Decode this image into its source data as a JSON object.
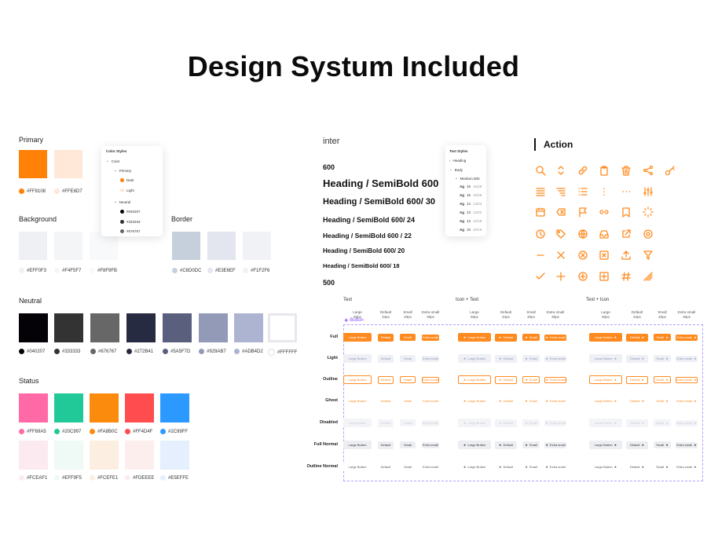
{
  "page": {
    "title": "Design Systum Included"
  },
  "colors": {
    "primary_label": "Primary",
    "primary": [
      {
        "hex": "#FF8108",
        "color": "#FF8108"
      },
      {
        "hex": "#FFE8D7",
        "color": "#FFE8D7"
      }
    ],
    "background_label": "Background",
    "background": [
      {
        "hex": "#EFF0F3",
        "color": "#EFF0F3"
      },
      {
        "hex": "#F4F5F7",
        "color": "#F4F5F7"
      },
      {
        "hex": "#F8F9FB",
        "color": "#F8F9FB"
      }
    ],
    "border_label": "Border",
    "border": [
      {
        "hex": "#C6D0DC",
        "color": "#C6D0DC"
      },
      {
        "hex": "#E3E6EF",
        "color": "#E3E6EF"
      },
      {
        "hex": "#F1F2F6",
        "color": "#F1F2F6"
      }
    ],
    "neutral_label": "Neutral",
    "neutral": [
      {
        "hex": "#040207",
        "color": "#040207"
      },
      {
        "hex": "#333333",
        "color": "#333333"
      },
      {
        "hex": "#676767",
        "color": "#676767"
      },
      {
        "hex": "#272B41",
        "color": "#272B41"
      },
      {
        "hex": "#5A5F7D",
        "color": "#5A5F7D"
      },
      {
        "hex": "#929AB7",
        "color": "#929AB7"
      },
      {
        "hex": "#ADB4D2",
        "color": "#ADB4D2"
      },
      {
        "hex": "#FFFFFF",
        "color": "#FFFFFF"
      }
    ],
    "status_label": "Status",
    "status": [
      {
        "hex": "#FF69A5",
        "color": "#FF69A5"
      },
      {
        "hex": "#20C997",
        "color": "#20C997"
      },
      {
        "hex": "#FA8B0C",
        "color": "#FA8B0C"
      },
      {
        "hex": "#FF4D4F",
        "color": "#FF4D4F"
      },
      {
        "hex": "#2C99FF",
        "color": "#2C99FF"
      }
    ],
    "status_light": [
      {
        "hex": "#FCEAF1",
        "color": "#FCEAF1"
      },
      {
        "hex": "#EFF9F5",
        "color": "#EFF9F5"
      },
      {
        "hex": "#FCEFE1",
        "color": "#FCEFE1"
      },
      {
        "hex": "#FDEEEE",
        "color": "#FDEEEE"
      },
      {
        "hex": "#E5EFFE",
        "color": "#E5EFFE"
      }
    ]
  },
  "color_styles_panel": {
    "title": "Color Styles",
    "root": "Color",
    "primary": "Primary",
    "dark": "Dark",
    "light": "Light",
    "neutral": "Neutral",
    "neutral_items": [
      "#040207",
      "#333333",
      "#676767"
    ]
  },
  "typography": {
    "font": "inter",
    "weight_600": "600",
    "weight_500": "500",
    "headings": [
      "Heading / SemiBold 600",
      "Heading / SemiBold 600/ 30",
      "Heading / SemiBold 600/ 24",
      "Heading / SemiBold 600 / 22",
      "Heading / SemiBold 600/ 20",
      "Heading / SemiBold 600/ 18"
    ]
  },
  "text_styles_panel": {
    "title": "Text Styles",
    "heading": "Heading",
    "body": "Body",
    "medium": "Medium 500",
    "rows": [
      {
        "ag": "Ag",
        "size": "16",
        "lh": "16/28"
      },
      {
        "ag": "Ag",
        "size": "15",
        "lh": "15/26"
      },
      {
        "ag": "Ag",
        "size": "14",
        "lh": "14/24"
      },
      {
        "ag": "Ag",
        "size": "13",
        "lh": "13/22"
      },
      {
        "ag": "Ag",
        "size": "12",
        "lh": "12/18"
      },
      {
        "ag": "Ag",
        "size": "10",
        "lh": "10/16"
      }
    ]
  },
  "action": {
    "title": "Action",
    "icons": [
      [
        "search-icon",
        "chevron-up-down-icon",
        "link-icon",
        "clipboard-icon",
        "trash-icon",
        "share-icon",
        "key-icon"
      ],
      [
        "align-center-icon",
        "align-right-icon",
        "list-icon",
        "more-vertical-icon",
        "more-horizontal-icon",
        "sliders-icon"
      ],
      [
        "calendar-icon",
        "backspace-icon",
        "flag-icon",
        "link-alt-icon",
        "bookmark-icon",
        "loader-icon"
      ],
      [
        "clock-icon",
        "tag-icon",
        "globe-icon",
        "inbox-icon",
        "external-link-icon",
        "settings-icon"
      ],
      [
        "minus-icon",
        "close-icon",
        "close-circle-icon",
        "close-square-icon",
        "upload-icon",
        "filter-icon"
      ],
      [
        "check-icon",
        "plus-icon",
        "plus-circle-icon",
        "plus-square-icon",
        "hash-icon",
        "slash-icon"
      ]
    ]
  },
  "buttons": {
    "component_label": "Button",
    "groups": [
      "Text",
      "Icon + Text",
      "Text + Icon"
    ],
    "sizes": [
      {
        "name": "Large",
        "px": "50px"
      },
      {
        "name": "Default",
        "px": "44px"
      },
      {
        "name": "Small",
        "px": "40px"
      },
      {
        "name": "Extra small",
        "px": "30px"
      }
    ],
    "labels": [
      "Large Button",
      "Default",
      "Small",
      "Extra small"
    ],
    "rows": [
      "Full",
      "Light",
      "Outline",
      "Ghost",
      "Disabled",
      "Full Normal",
      "Outline Normal"
    ]
  }
}
